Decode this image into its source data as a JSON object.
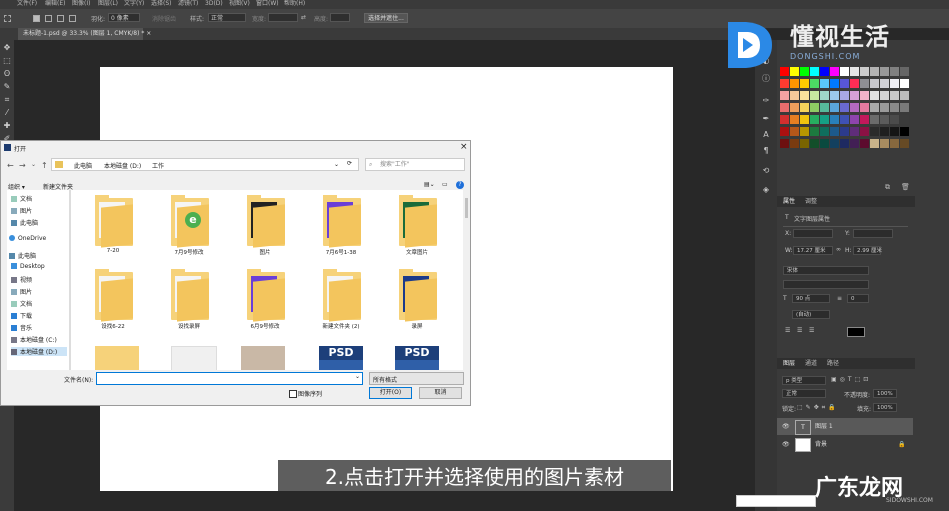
{
  "menubar": [
    "文件(F)",
    "编辑(E)",
    "图像(I)",
    "图层(L)",
    "文字(Y)",
    "选择(S)",
    "滤镜(T)",
    "3D(D)",
    "视图(V)",
    "窗口(W)",
    "帮助(H)"
  ],
  "options": {
    "feather_label": "羽化:",
    "feather_value": "0 像素",
    "antialias_label": "消除锯齿",
    "style_label": "样式:",
    "style_value": "正常",
    "width_label": "宽度:",
    "height_label": "高度:",
    "select_mask_button": "选择并遮住..."
  },
  "document_tab": "未标题-1.psd @ 33.3% (图层 1, CMYK/8) *",
  "dialog": {
    "title": "打开",
    "breadcrumb": [
      "此电脑",
      "本地磁盘 (D:)",
      "工作"
    ],
    "search_placeholder": "搜索\"工作\"",
    "organize": "组织 ▾",
    "new_folder": "新建文件夹",
    "nav_items": [
      "文档",
      "图片",
      "此电脑",
      "OneDrive",
      "此电脑",
      "Desktop",
      "视频",
      "图片",
      "文档",
      "下载",
      "音乐",
      "本地磁盘 (C:)",
      "本地磁盘 (D:)"
    ],
    "files": [
      "7-20",
      "7月9号修改",
      "图片",
      "7月6号1-38",
      "文章图片",
      "设找6-22",
      "设找录屏",
      "6月9号修改",
      "新建文件夹 (2)",
      "录屏"
    ],
    "psd_label": "PSD",
    "filename_label": "文件名(N):",
    "filetype_value": "所有格式",
    "image_sequence": "图像序列",
    "open_button": "打开(O)",
    "cancel_button": "取消"
  },
  "properties": {
    "tabs": [
      "属性",
      "调整"
    ],
    "type_label": "文字图层属性",
    "w_label": "W:",
    "w_value": "17.27 厘米",
    "h_label": "H:",
    "h_value": "2.99 厘米",
    "x_label": "X:",
    "y_label": "Y:",
    "font_family": "宋体",
    "font_size": "90 点",
    "leading": "(自动)",
    "tracking": "0"
  },
  "layers": {
    "tabs": [
      "图层",
      "通道",
      "路径"
    ],
    "filter_value": "p 类型",
    "blend_mode": "正常",
    "opacity_label": "不透明度:",
    "opacity_value": "100%",
    "lock_label": "锁定:",
    "fill_label": "填充:",
    "fill_value": "100%",
    "items": [
      {
        "name": "图层 1",
        "type": "T"
      },
      {
        "name": "背景",
        "type": "bg"
      }
    ]
  },
  "watermark": {
    "title": "懂视生活",
    "subtitle": "DONGSHI.COM",
    "caption": "2.点击打开并选择使用的图片素材",
    "brand2": "广东龙网",
    "brand2_sub": "SIDOWSHI.COM"
  },
  "colors": {
    "canvas": "#ffffff",
    "app_bg": "#282828",
    "accent": "#0078d7"
  }
}
